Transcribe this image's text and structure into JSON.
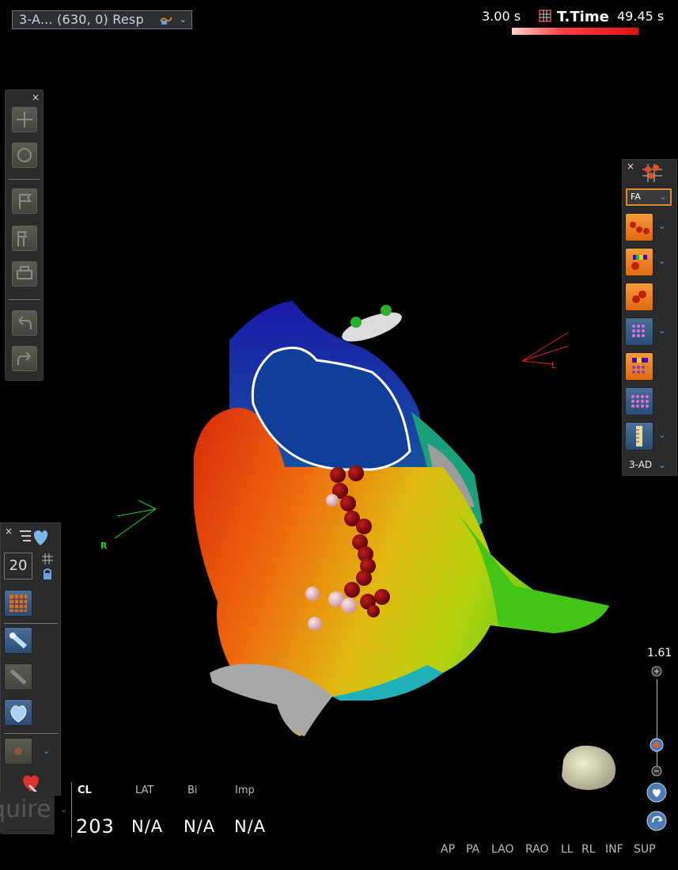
{
  "map_selector": {
    "label": "3-A... (630, 0) Resp"
  },
  "timeline": {
    "start_value": "3.00 s",
    "label": "T.Time",
    "end_value": "49.45 s"
  },
  "left_toolbar": {
    "close": "×",
    "tools": [
      "move-icon",
      "rotate-icon",
      "flag-icon",
      "multi-flag-icon",
      "print-icon",
      "undo-icon",
      "redo-icon"
    ]
  },
  "right_palette": {
    "close": "×",
    "fa_value": "FA",
    "bottom_value": "3-AD"
  },
  "left_palette": {
    "close": "×",
    "count_value": "20"
  },
  "acquire_button": {
    "label": "quire"
  },
  "stats": {
    "headers": [
      "CL",
      "LAT",
      "Bi",
      "Imp"
    ],
    "values": [
      "203",
      "N/A",
      "N/A",
      "N/A"
    ]
  },
  "view_buttons": [
    "AP",
    "PA",
    "LAO",
    "RAO",
    "LL",
    "RL",
    "INF",
    "SUP"
  ],
  "zoom": {
    "value": "1.61"
  },
  "orientation": {
    "right_label": "R",
    "left_label": "L"
  },
  "colors": {
    "accent_orange": "#e57a1f",
    "timeline_red": "#e01010",
    "palette_bg": "#2b2b2b"
  }
}
